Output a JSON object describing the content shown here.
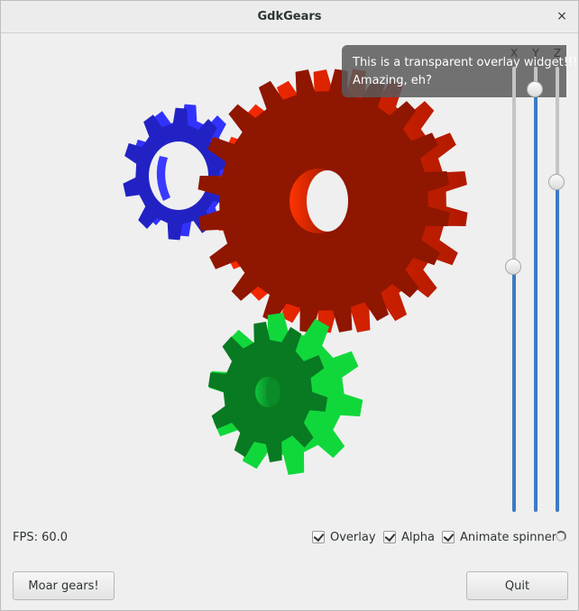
{
  "window": {
    "title": "GdkGears",
    "close_glyph": "×"
  },
  "overlay": {
    "line1": "This is a transparent overlay widget!!!!",
    "line2": "Amazing, eh?"
  },
  "sliders": [
    {
      "label": "X",
      "value_fraction": 0.55
    },
    {
      "label": "Y",
      "value_fraction": 0.95
    },
    {
      "label": "Z",
      "value_fraction": 0.74
    }
  ],
  "status": {
    "fps": "FPS: 60.0"
  },
  "options": [
    {
      "label": "Overlay",
      "checked": true
    },
    {
      "label": "Alpha",
      "checked": true
    },
    {
      "label": "Animate spinner",
      "checked": true
    }
  ],
  "buttons": {
    "more_gears": "Moar gears!",
    "quit": "Quit"
  },
  "colors": {
    "red_gear": "#a51800",
    "green_gear": "#0d9e2a",
    "blue_gear": "#2424c8",
    "slider_fill": "#3d7bc4"
  }
}
